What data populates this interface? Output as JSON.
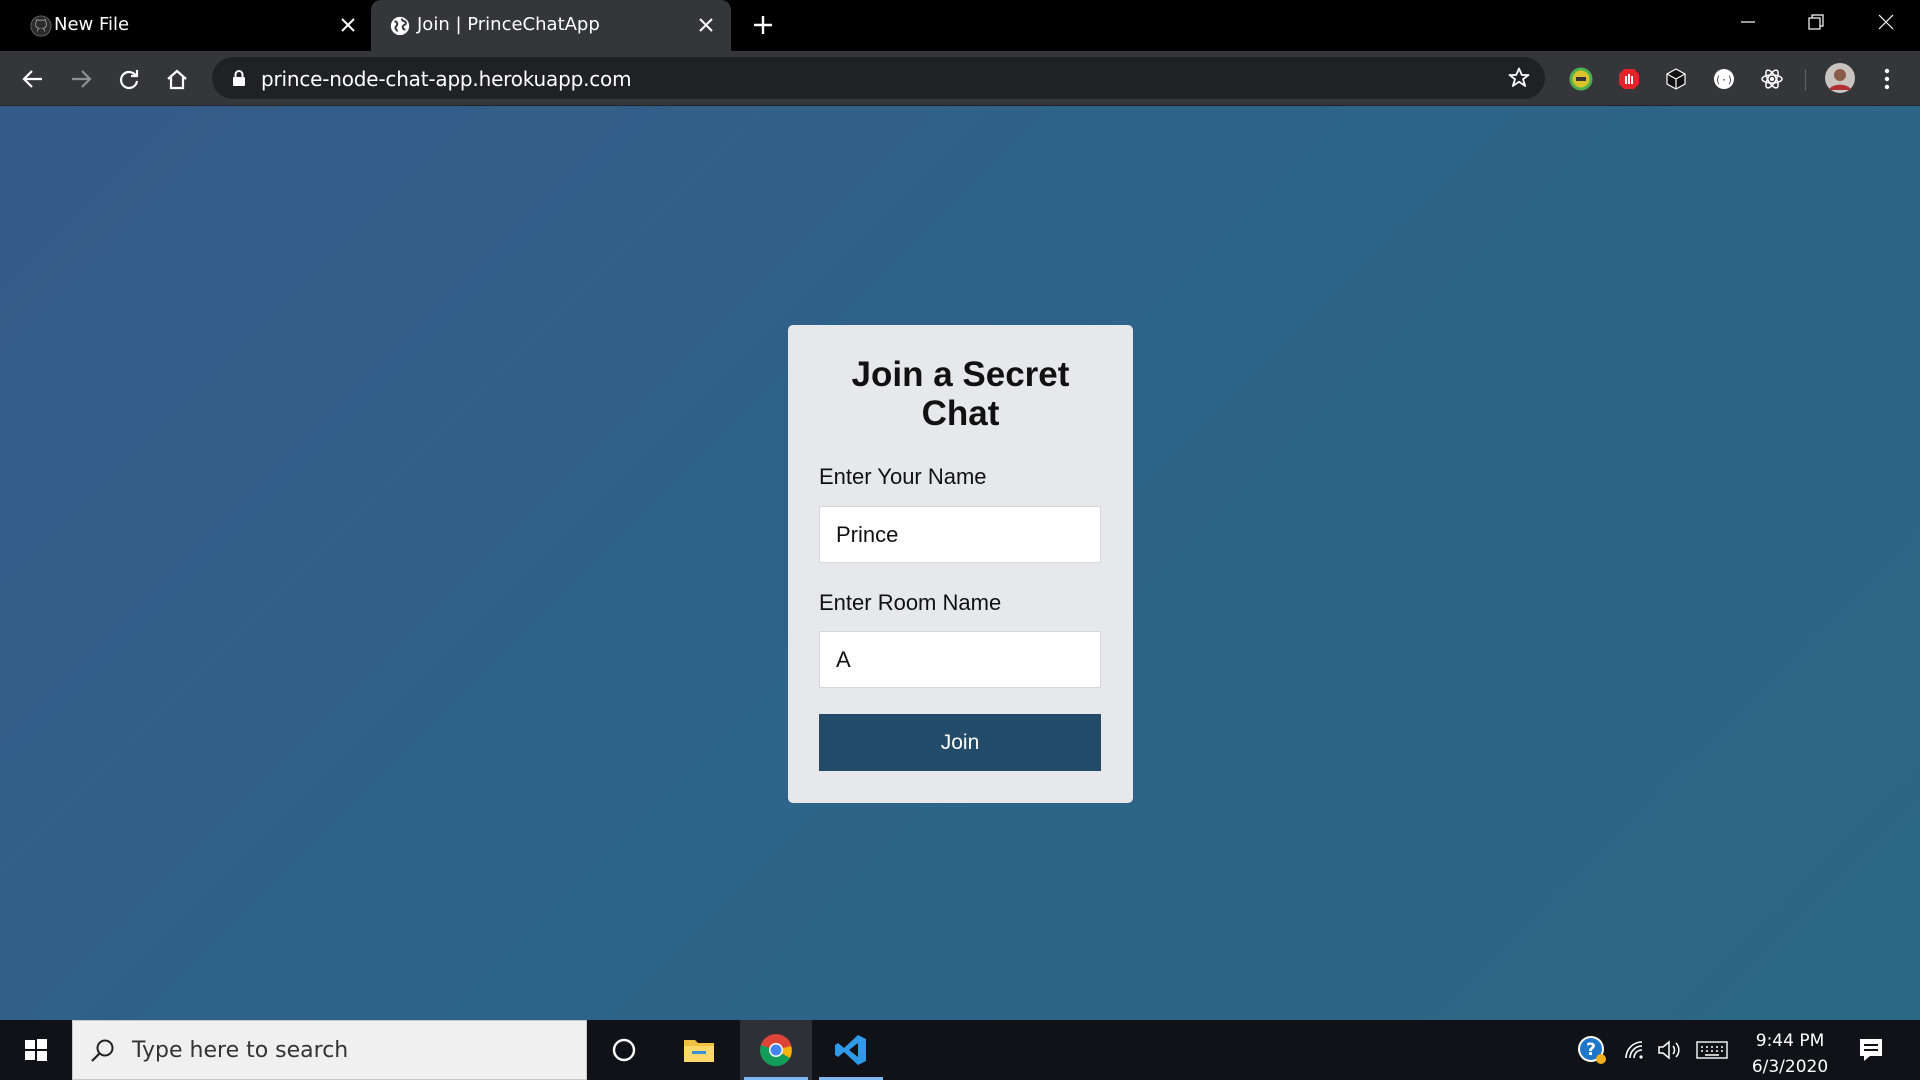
{
  "browser": {
    "tabs": [
      {
        "title": "New File",
        "favicon": "github-icon",
        "active": false
      },
      {
        "title": "Join | PrinceChatApp",
        "favicon": "globe-icon",
        "active": true
      }
    ],
    "url": "prince-node-chat-app.herokuapp.com",
    "extensions": [
      "coin-extension-icon",
      "stop-hand-extension-icon",
      "cube-extension-icon",
      "circle-extension-icon",
      "react-devtools-icon"
    ],
    "accent_colors": {
      "tab_active": "#35363a",
      "omnibox": "#202124"
    }
  },
  "page": {
    "background_colors": [
      "#355a87",
      "#2b6884"
    ],
    "form": {
      "title": "Join a Secret Chat",
      "name_label": "Enter Your Name",
      "name_value": "Prince",
      "room_label": "Enter Room Name",
      "room_value": "A",
      "join_label": "Join",
      "button_color": "#224c69"
    }
  },
  "taskbar": {
    "search_placeholder": "Type here to search",
    "pinned_apps": [
      "cortana-icon",
      "file-explorer-icon",
      "chrome-icon",
      "vscode-icon"
    ],
    "time": "9:44 PM",
    "date": "6/3/2020"
  }
}
